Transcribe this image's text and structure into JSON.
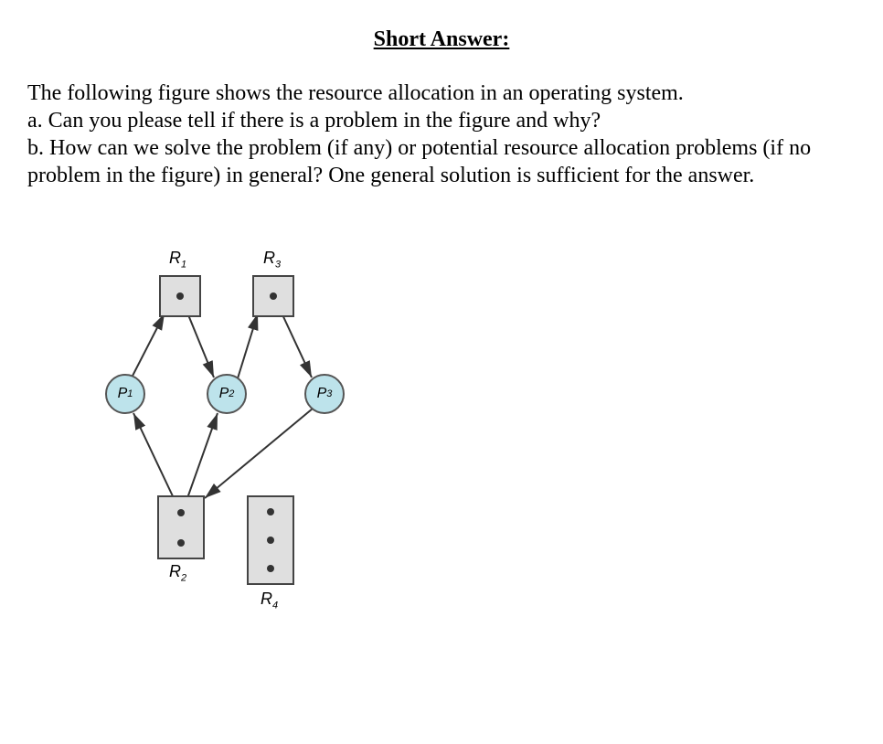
{
  "title": "Short Answer:",
  "question": {
    "intro": "The following figure shows the resource allocation in an operating system.",
    "part_a": "a. Can you please tell if there is a problem in the figure and why?",
    "part_b": "b. How can we solve the problem (if any) or potential resource allocation problems (if no problem in the figure) in general? One general solution is sufficient for the answer."
  },
  "diagram": {
    "resources": {
      "R1": {
        "label": "R",
        "sub": "1",
        "instances": 1
      },
      "R2": {
        "label": "R",
        "sub": "2",
        "instances": 2
      },
      "R3": {
        "label": "R",
        "sub": "3",
        "instances": 1
      },
      "R4": {
        "label": "R",
        "sub": "4",
        "instances": 3
      }
    },
    "processes": {
      "P1": {
        "label": "P",
        "sub": "1"
      },
      "P2": {
        "label": "P",
        "sub": "2"
      },
      "P3": {
        "label": "P",
        "sub": "3"
      }
    },
    "edges": [
      {
        "type": "request",
        "from": "P1",
        "to": "R1"
      },
      {
        "type": "assign",
        "from": "R1",
        "to": "P2"
      },
      {
        "type": "request",
        "from": "P2",
        "to": "R3"
      },
      {
        "type": "assign",
        "from": "R3",
        "to": "P3"
      },
      {
        "type": "assign",
        "from": "R2",
        "to": "P1"
      },
      {
        "type": "assign",
        "from": "R2",
        "to": "P2"
      },
      {
        "type": "request",
        "from": "P3",
        "to": "R2"
      }
    ]
  }
}
